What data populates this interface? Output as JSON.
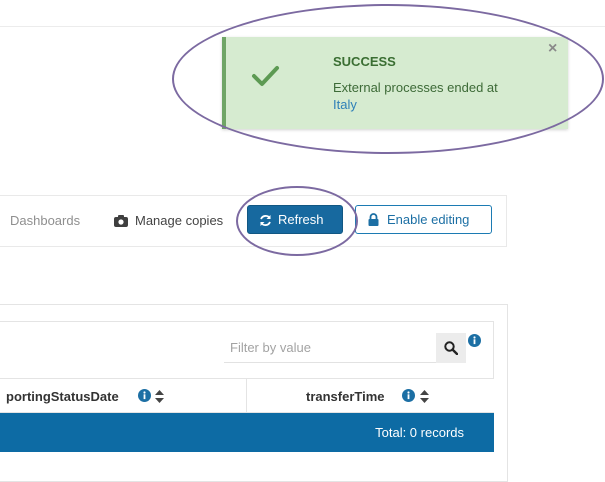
{
  "toast": {
    "title": "SUCCESS",
    "message": "External processes ended at",
    "link": "Italy",
    "close": "×",
    "check_icon": "check-icon",
    "colors": {
      "background": "#d6ebd0",
      "accent": "#6fa566",
      "link": "#2f80b8"
    }
  },
  "toolbar": {
    "dashboards_label": "Dashboards",
    "manage_copies_label": "Manage copies",
    "refresh_label": "Refresh",
    "enable_editing_label": "Enable editing",
    "colors": {
      "primary": "#17699f"
    }
  },
  "table": {
    "filter_placeholder": "Filter by value",
    "columns": [
      {
        "label": "portingStatusDate"
      },
      {
        "label": "transferTime"
      }
    ],
    "total_label": "Total: 0 records",
    "colors": {
      "total_row": "#0d6ba4"
    }
  },
  "annotations": {
    "color": "#7c6aa1"
  }
}
